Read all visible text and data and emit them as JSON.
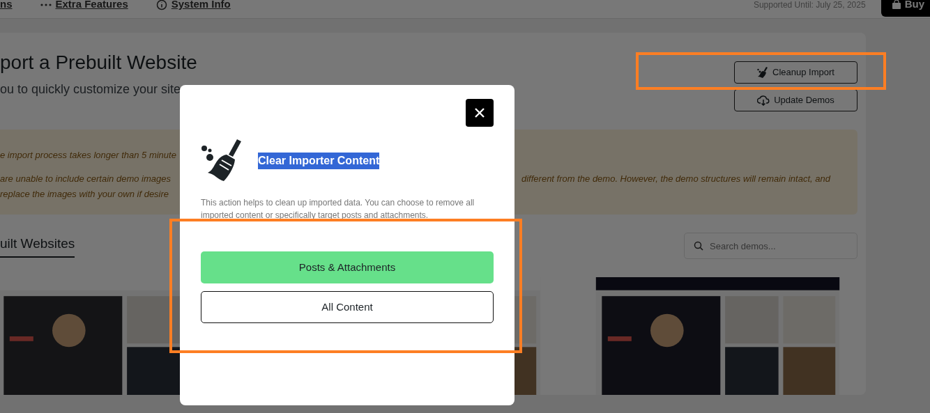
{
  "top_nav": {
    "items": [
      {
        "label": "ns",
        "kind": "plain"
      },
      {
        "label": "Extra Features",
        "kind": "dots"
      },
      {
        "label": "System Info",
        "kind": "info"
      }
    ],
    "support_text": "Supported Until: July 25, 2025",
    "buy_button": "Buy"
  },
  "header": {
    "title": "port a Prebuilt Website",
    "subtitle": "ou to quickly customize your site",
    "buttons": [
      {
        "label": "Cleanup Import",
        "kind": "broom",
        "highlighted": true
      },
      {
        "label": "Update Demos",
        "kind": "cloud",
        "highlighted": false
      }
    ]
  },
  "notice": {
    "lines": [
      {
        "left": "e import process takes longer than 5 minute"
      },
      {
        "left": "are unable to include certain demo images",
        "right": "different from the demo. However, the demo structures will remain intact, and"
      },
      {
        "left": "replace the images with your own if desire"
      }
    ]
  },
  "demos": {
    "tab": "uilt Websites",
    "search": {
      "placeholder": "Search demos..."
    }
  },
  "modal": {
    "title": "Clear Importer Content",
    "title_selected": true,
    "description": "This action helps to clean up imported data. You can choose to remove all imported content or specifically target posts and attachments.",
    "buttons": [
      {
        "label": "Posts & Attachments",
        "kind": "filled"
      },
      {
        "label": "All Content",
        "kind": "outline"
      }
    ],
    "highlighted": true
  }
}
